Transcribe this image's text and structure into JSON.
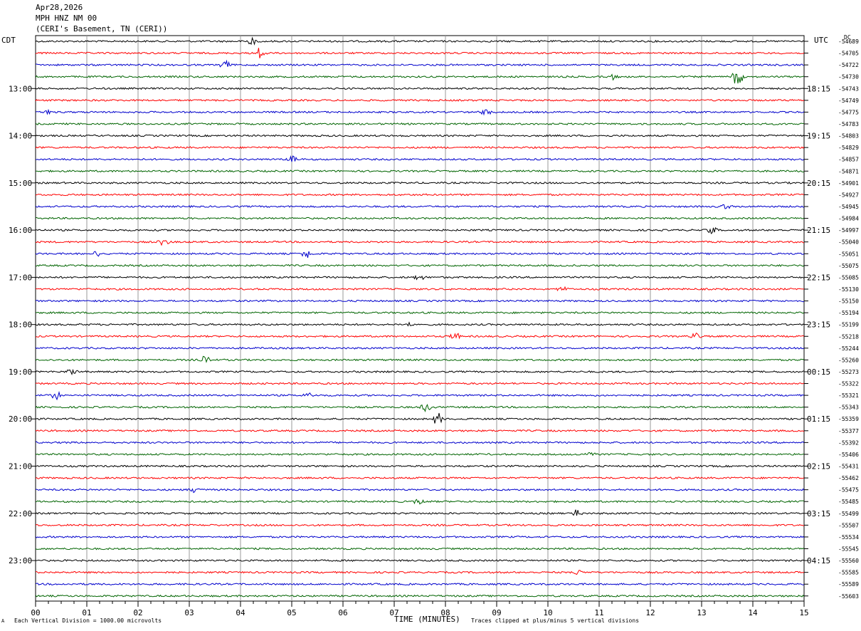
{
  "header": {
    "date": "Apr28,2026",
    "station": "MPH HNZ NM 00",
    "location": "(CERI's Basement, TN (CERI))"
  },
  "left_timezone": "CDT",
  "right_timezone": "UTC",
  "dc_label": "DC",
  "footer": {
    "scale_note": "Each Vertical Division = 1000.00 microvolts",
    "axis_title": "TIME (MINUTES)",
    "clip_note": "Traces clipped at plus/minus 5 vertical divisions",
    "corner_mark": "A"
  },
  "colors": {
    "trace_cycle": [
      "#000000",
      "#ff0000",
      "#0000cc",
      "#006400"
    ],
    "grid": "#999999"
  },
  "chart_data": {
    "type": "line",
    "title": "",
    "xlabel": "TIME (MINUTES)",
    "ylabel": "",
    "x_range": [
      0,
      15
    ],
    "x_ticks": [
      "00",
      "01",
      "02",
      "03",
      "04",
      "05",
      "06",
      "07",
      "08",
      "09",
      "10",
      "11",
      "12",
      "13",
      "14",
      "15"
    ],
    "left_hour_labels": [
      "13:00",
      "14:00",
      "15:00",
      "16:00",
      "17:00",
      "18:00",
      "19:00",
      "20:00",
      "21:00",
      "22:00",
      "23:00"
    ],
    "right_hour_labels": [
      "18:15",
      "19:15",
      "20:15",
      "21:15",
      "22:15",
      "23:15",
      "00:15",
      "01:15",
      "02:15",
      "03:15",
      "04:15"
    ],
    "dc_offsets": [
      "-54689",
      "-54705",
      "-54722",
      "-54730",
      "-54743",
      "-54749",
      "-54775",
      "-54783",
      "-54803",
      "-54829",
      "-54857",
      "-54871",
      "-54901",
      "-54927",
      "-54945",
      "-54984",
      "-54997",
      "-55040",
      "-55051",
      "-55075",
      "-55085",
      "-55130",
      "-55150",
      "-55194",
      "-55199",
      "-55218",
      "-55244",
      "-55260",
      "-55273",
      "-55322",
      "-55321",
      "-55343",
      "-55359",
      "-55377",
      "-55392",
      "-55406",
      "-55431",
      "-55462",
      "-55475",
      "-55485",
      "-55499",
      "-55507",
      "-55534",
      "-55545",
      "-55560",
      "-55585",
      "-55589",
      "-55603"
    ],
    "grid": true,
    "events": [
      {
        "trace": 0,
        "minute": 4.2,
        "amplitude": 0.35
      },
      {
        "trace": 1,
        "minute": 4.4,
        "amplitude": 0.6
      },
      {
        "trace": 2,
        "minute": 3.7,
        "amplitude": 0.45
      },
      {
        "trace": 3,
        "minute": 13.7,
        "amplitude": 0.9
      },
      {
        "trace": 3,
        "minute": 11.3,
        "amplitude": 0.35
      },
      {
        "trace": 6,
        "minute": 8.8,
        "amplitude": 0.35
      },
      {
        "trace": 6,
        "minute": 0.2,
        "amplitude": 0.3
      },
      {
        "trace": 10,
        "minute": 5.0,
        "amplitude": 0.35
      },
      {
        "trace": 14,
        "minute": 13.5,
        "amplitude": 0.3
      },
      {
        "trace": 16,
        "minute": 13.2,
        "amplitude": 0.3
      },
      {
        "trace": 17,
        "minute": 2.5,
        "amplitude": 0.35
      },
      {
        "trace": 18,
        "minute": 5.3,
        "amplitude": 0.45
      },
      {
        "trace": 18,
        "minute": 1.2,
        "amplitude": 0.3
      },
      {
        "trace": 20,
        "minute": 7.5,
        "amplitude": 0.3
      },
      {
        "trace": 21,
        "minute": 10.3,
        "amplitude": 0.3
      },
      {
        "trace": 24,
        "minute": 7.3,
        "amplitude": 0.25
      },
      {
        "trace": 25,
        "minute": 8.2,
        "amplitude": 0.35
      },
      {
        "trace": 25,
        "minute": 12.9,
        "amplitude": 0.3
      },
      {
        "trace": 27,
        "minute": 3.3,
        "amplitude": 0.35
      },
      {
        "trace": 28,
        "minute": 0.7,
        "amplitude": 0.3
      },
      {
        "trace": 30,
        "minute": 0.4,
        "amplitude": 0.35
      },
      {
        "trace": 30,
        "minute": 5.3,
        "amplitude": 0.3
      },
      {
        "trace": 31,
        "minute": 7.6,
        "amplitude": 0.45
      },
      {
        "trace": 32,
        "minute": 7.85,
        "amplitude": 0.55
      },
      {
        "trace": 35,
        "minute": 10.8,
        "amplitude": 0.4
      },
      {
        "trace": 38,
        "minute": 3.1,
        "amplitude": 0.3
      },
      {
        "trace": 39,
        "minute": 7.5,
        "amplitude": 0.35
      },
      {
        "trace": 40,
        "minute": 10.55,
        "amplitude": 0.3
      },
      {
        "trace": 45,
        "minute": 10.6,
        "amplitude": 0.3
      }
    ]
  }
}
